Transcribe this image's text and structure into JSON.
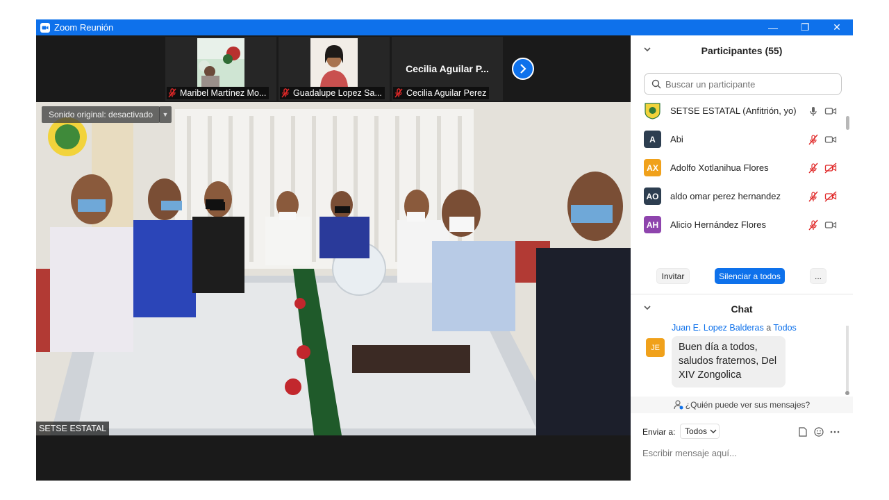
{
  "window": {
    "title": "Zoom Reunión",
    "minimize": "—",
    "restore": "❐",
    "close": "✕"
  },
  "thumbnails": [
    {
      "name": "Maribel Martínez Mo...",
      "mic": "muted",
      "has_video": true
    },
    {
      "name": "Guadalupe Lopez Sa...",
      "mic": "muted",
      "has_video": true
    },
    {
      "name": "Cecilia Aguilar Perez",
      "display_name": "Cecilia Aguilar P...",
      "mic": "muted",
      "has_video": false
    }
  ],
  "main_video": {
    "sound_label": "Sonido original: desactivado",
    "speaker_name": "SETSE ESTATAL"
  },
  "participants": {
    "title": "Participantes (55)",
    "search_placeholder": "Buscar un participante",
    "items": [
      {
        "initials": "",
        "name": "SETSE ESTATAL (Anfitrión, yo)",
        "avatar_color": "#2f7a3a",
        "is_logo": true,
        "mic": "on",
        "cam": "on"
      },
      {
        "initials": "A",
        "name": "Abi",
        "avatar_color": "#2d3e50",
        "mic": "muted",
        "cam": "on"
      },
      {
        "initials": "AX",
        "name": "Adolfo Xotlanihua Flores",
        "avatar_color": "#f0a11b",
        "mic": "muted",
        "cam": "off"
      },
      {
        "initials": "AO",
        "name": "aldo omar perez hernandez",
        "avatar_color": "#2d3e50",
        "mic": "muted",
        "cam": "off"
      },
      {
        "initials": "AH",
        "name": "Alicio Hernández Flores",
        "avatar_color": "#8e44ad",
        "mic": "muted",
        "cam": "on"
      }
    ],
    "invite_label": "Invitar",
    "mute_all_label": "Silenciar a todos",
    "more_label": "..."
  },
  "chat": {
    "title": "Chat",
    "sender": "Juan E. Lopez Balderas",
    "to_word": "a",
    "recipient": "Todos",
    "sender_initials": "JE",
    "message": "Buen día a todos, saludos fraternos, Del XIV Zongolica",
    "who_can_see": "¿Quién puede ver sus mensajes?",
    "send_to_label": "Enviar a:",
    "send_to_value": "Todos",
    "input_placeholder": "Escribir mensaje aquí..."
  },
  "colors": {
    "accent": "#0e71eb",
    "muted_red": "#e02828"
  }
}
